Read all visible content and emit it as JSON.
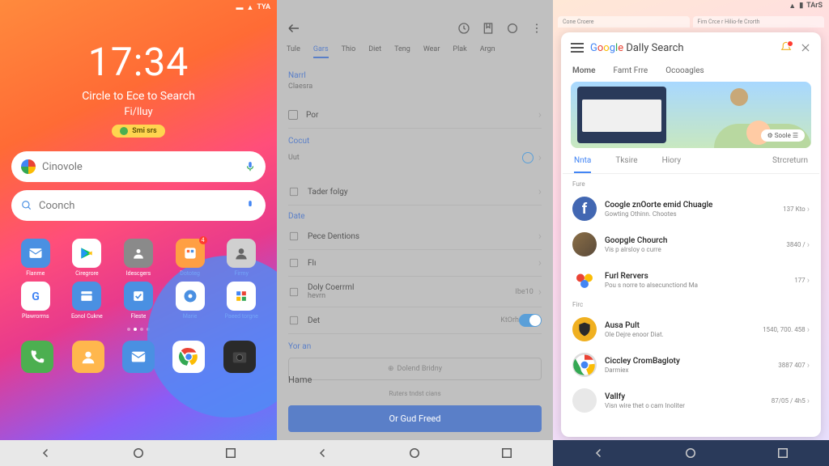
{
  "panel1": {
    "status": {
      "time": "TYA"
    },
    "clock": {
      "time": "17:34",
      "subtitle": "Circle to Ece to Search",
      "day": "Fi/lluy",
      "pill": "Smi srs"
    },
    "search1": {
      "placeholder": "Cinovole"
    },
    "search2": {
      "placeholder": "Coonch"
    },
    "apps": [
      {
        "label": "Flanme",
        "color": "#4a90e2"
      },
      {
        "label": "Ciregrore",
        "color": "#ffffff"
      },
      {
        "label": "Idescgers",
        "color": "#8a8a8a"
      },
      {
        "label": "Dototeg",
        "color": "#ff9f43",
        "badge": "4"
      },
      {
        "label": "Firmy",
        "color": "#d0d0d0"
      },
      {
        "label": "Plawrorrns",
        "color": "#ffffff"
      },
      {
        "label": "Eonol Cukne",
        "color": "#4a90e2"
      },
      {
        "label": "Fleste",
        "color": "#4a90e2"
      },
      {
        "label": "Marie",
        "color": "#ffffff"
      },
      {
        "label": "Paeed torgne",
        "color": "#ffffff"
      }
    ],
    "dock": [
      {
        "name": "phone",
        "color": "#4caf50"
      },
      {
        "name": "contacts",
        "color": "#ffb74d"
      },
      {
        "name": "messages",
        "color": "#4a90e2"
      },
      {
        "name": "chrome",
        "color": "#ffffff"
      },
      {
        "name": "camera",
        "color": "#2a2a2a"
      }
    ]
  },
  "panel2": {
    "tabs": [
      "Tule",
      "Gars",
      "Thio",
      "Diet",
      "Teng",
      "Wear",
      "Plak",
      "Argn"
    ],
    "active_tab": 1,
    "name_label": "Narrl",
    "name_value": "Claesra",
    "checkbox_label": "Por",
    "section2_label": "Cocut",
    "section2_value": "Uut",
    "rows": [
      {
        "text": "Tader folgy"
      },
      {
        "header": "Date"
      },
      {
        "text": "Pece Dentions"
      },
      {
        "text": "Flı"
      },
      {
        "text": "Doly Coerrml",
        "sub": "hevrn",
        "end": "Ibe10"
      },
      {
        "text": "Det",
        "end": "KtOrh",
        "toggle": true
      }
    ],
    "yor_label": "Yor an",
    "banner": "Dolend Bridny",
    "home_label": "Hame",
    "note": "Ruters tndst cians",
    "cta": "Or Gud Freed"
  },
  "panel3": {
    "status_time": "TArS",
    "browser_tabs": [
      "Cone Croere",
      "Firn Crce r Hilio-fe Crorth"
    ],
    "title_rest": " Dally Search",
    "nav": [
      "Mome",
      "Famt Frre",
      "Ocooagles"
    ],
    "banner_pill": "⚙ Soole  ☰",
    "tabs2": [
      "Nnta",
      "Tksire",
      "Hiory",
      "Strcreturn"
    ],
    "list_header1": "Fure",
    "list_header2": "Firc",
    "items": [
      {
        "title": "Coogle znOorte emid Chuagle",
        "sub": "Gowting Othinn. Chootes",
        "end": "137 Kto",
        "color": "#4267B2",
        "letter": "f"
      },
      {
        "title": "Goopgle Chourch",
        "sub": "Vis p alrsloy o curre",
        "end": "3840 /",
        "img": true
      },
      {
        "title": "Furl Rervers",
        "sub": "Pou s norre to alsecunctiond Ma",
        "end": "177",
        "color": "#fff",
        "multi": true
      },
      {
        "title": "Ausa Pult",
        "sub": "Ole Dejre enoor Diat.",
        "end": "1540, 700. 458",
        "color": "#f0b020",
        "shield": true
      },
      {
        "title": "Ciccley CromBagloty",
        "sub": "Darmiex",
        "end": "3887 407",
        "chrome": true
      },
      {
        "title": "Vallfy",
        "sub": "Visn wire thet o cam Inoliter",
        "end": "87/05 / 4h5",
        "color": "#e8e8e8"
      }
    ]
  }
}
